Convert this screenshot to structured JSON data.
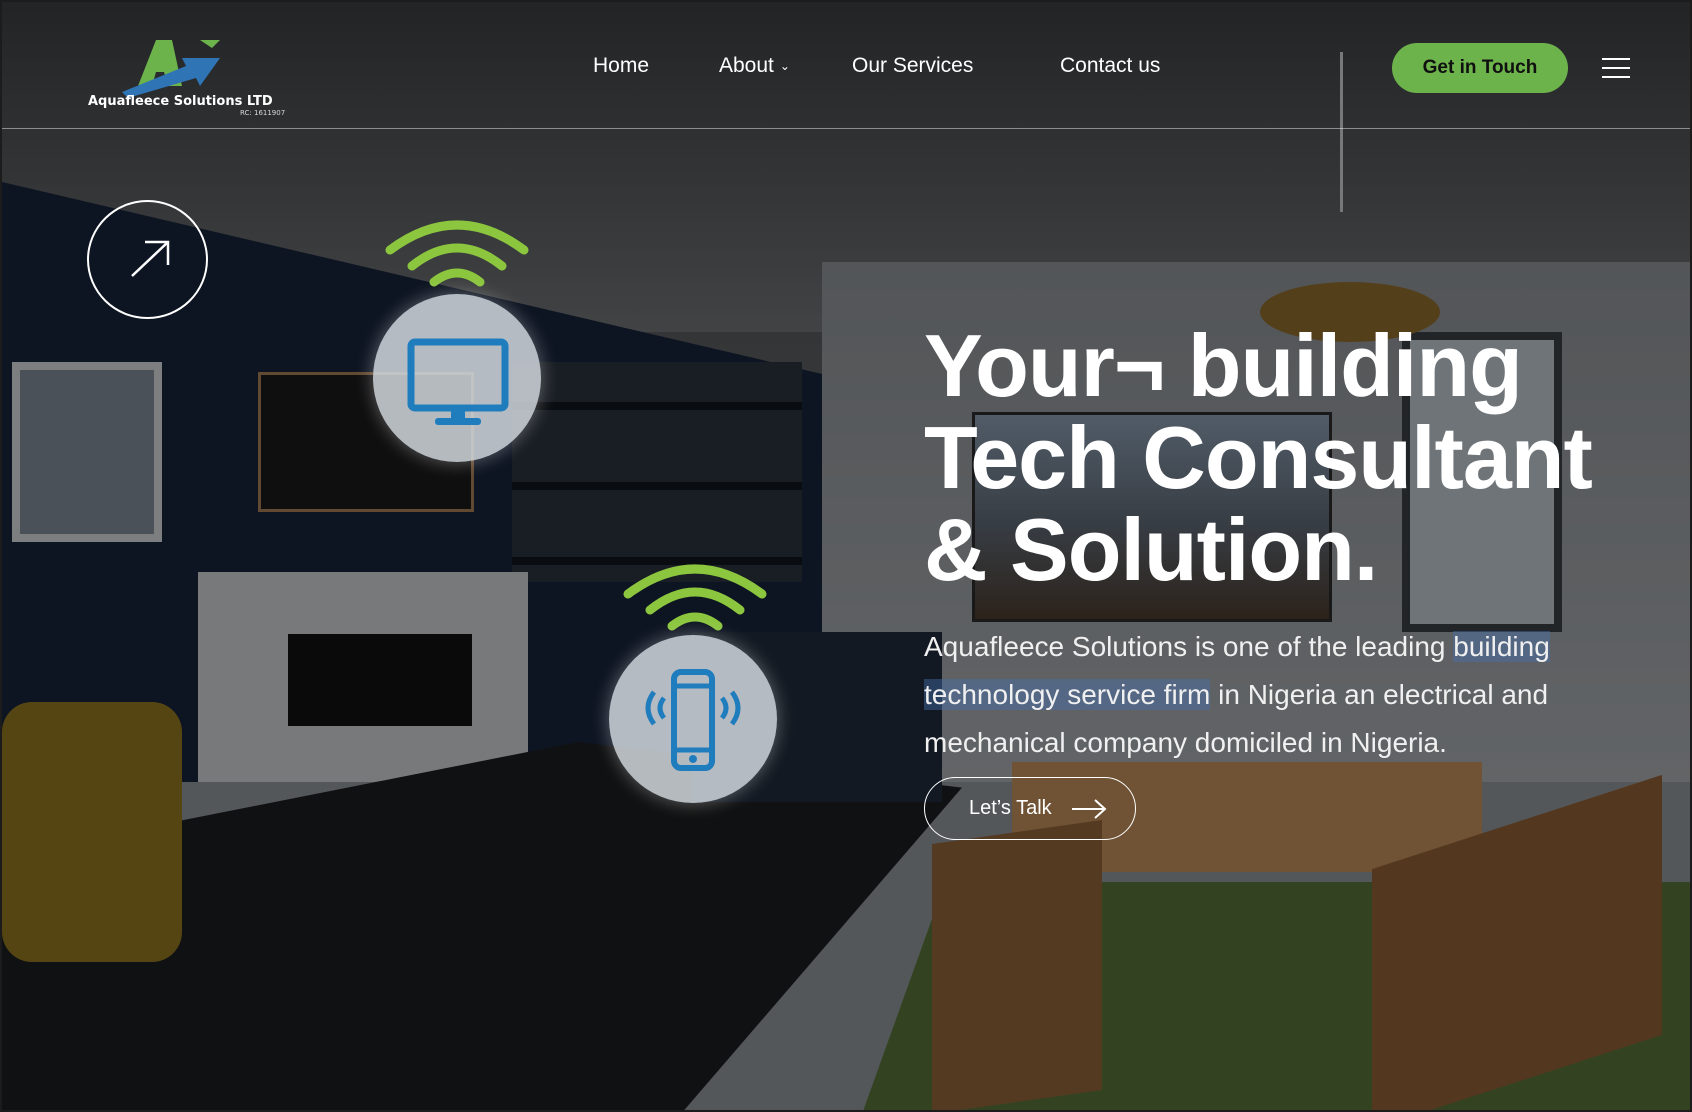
{
  "brand": {
    "name": "Aquafleece Solutions LTD",
    "rc": "RC: 1611907"
  },
  "nav": {
    "items": [
      {
        "label": "Home"
      },
      {
        "label": "About"
      },
      {
        "label": "Our Services"
      },
      {
        "label": "Contact us"
      }
    ],
    "cta_label": "Get in Touch"
  },
  "hero": {
    "title_lines": [
      "Your¬ building",
      "Tech Consultant",
      "& Solution."
    ],
    "description": {
      "part1": "Aquafleece Solutions is one of the leading ",
      "highlight": "building technology service firm",
      "part2": " in Nigeria an electrical and mechanical company domiciled in Nigeria."
    },
    "button_label": "Let’s Talk"
  },
  "icons": {
    "menu": "hamburger-icon",
    "arrow": "arrow-up-right-icon",
    "wifi": "wifi-signal-icon",
    "monitor": "monitor-icon",
    "phone": "smartphone-icon"
  },
  "colors": {
    "accent_green": "#6db34b",
    "device_blue": "#1f7dbd",
    "wifi_green": "#8cc63f"
  }
}
